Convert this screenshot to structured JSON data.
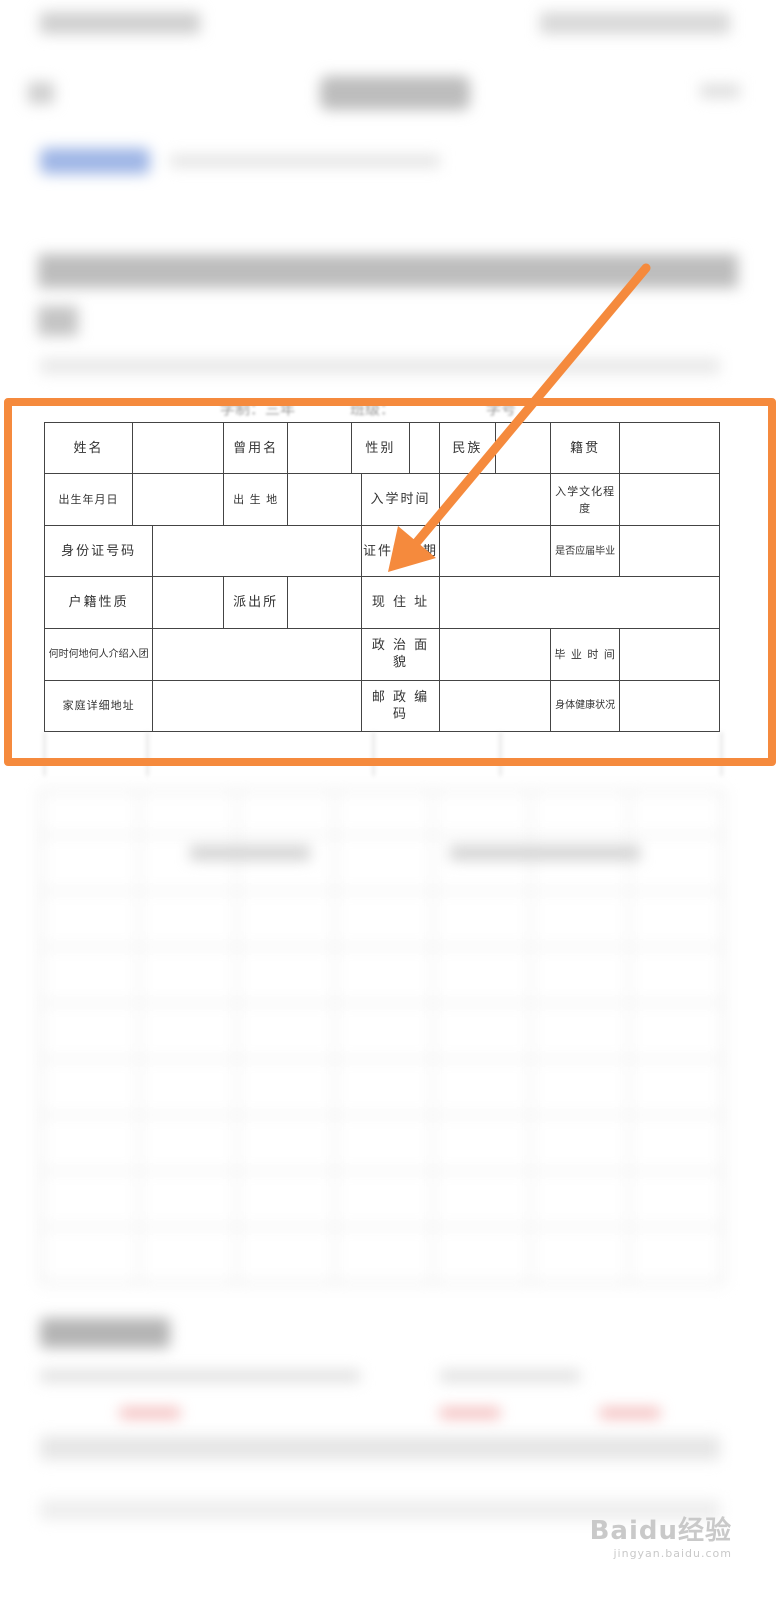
{
  "form": {
    "header": {
      "prefix": "学制：三年",
      "class_label": "班级：",
      "student_no_label": "学号"
    },
    "rows": [
      [
        "姓名",
        "",
        "曾用名",
        "",
        "性别",
        "",
        "民族",
        "",
        "籍贯",
        ""
      ],
      [
        "出生年月日",
        "",
        "出 生 地",
        "",
        "入学时间",
        "",
        "入学文化程度",
        ""
      ],
      [
        "身份证号码",
        "",
        "证件有效期",
        "",
        "是否应届毕业",
        ""
      ],
      [
        "户籍性质",
        "",
        "派出所",
        "",
        "现 住 址",
        ""
      ],
      [
        "何时何地何人介绍入团",
        "",
        "政 治 面 貌",
        "",
        "毕 业 时 间",
        ""
      ],
      [
        "家庭详细地址",
        "",
        "邮 政 编 码",
        "",
        "身体健康状况",
        ""
      ]
    ]
  },
  "annotation": {
    "highlight_color": "#f58a3d",
    "arrow_color": "#f58a3d"
  },
  "watermark": {
    "brand": "Baidu经验",
    "url": "jingyan.baidu.com"
  }
}
